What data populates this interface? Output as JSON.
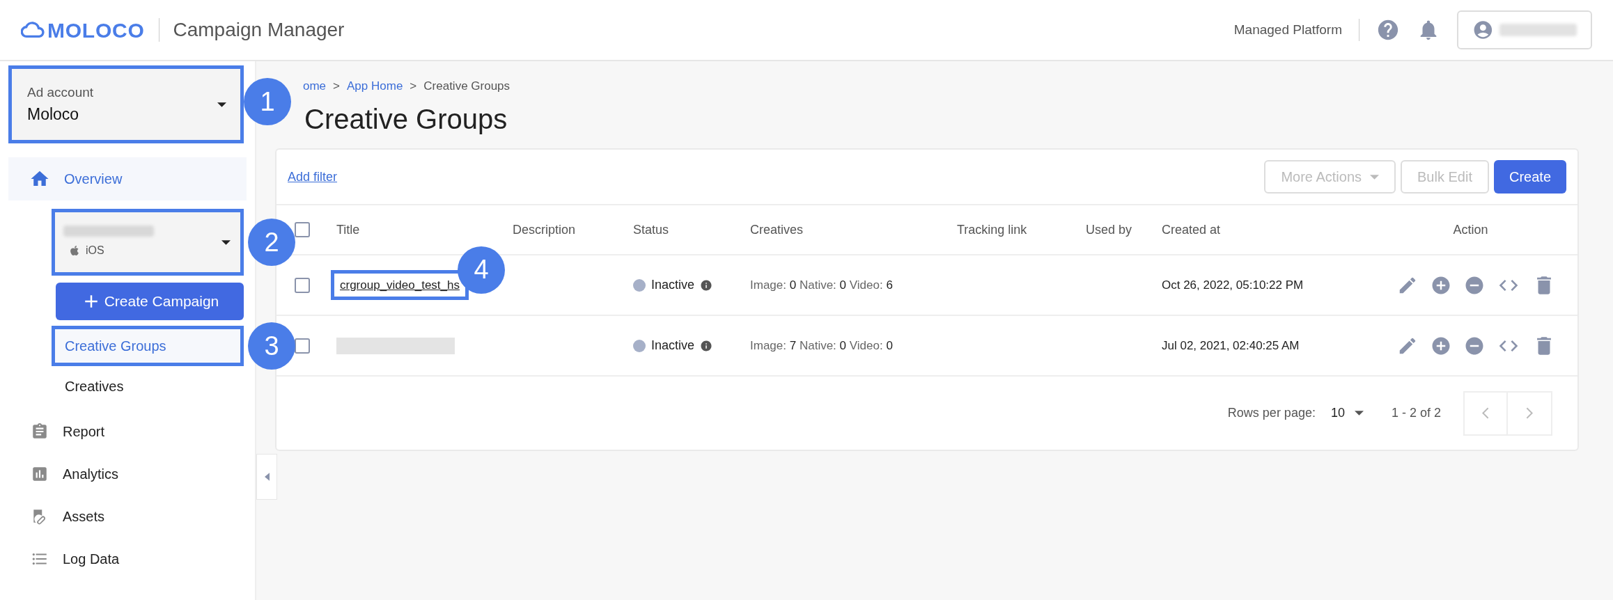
{
  "header": {
    "logo_text": "MOLOCO",
    "app_title": "Campaign Manager",
    "platform": "Managed Platform"
  },
  "sidebar": {
    "account": {
      "label": "Ad account",
      "value": "Moloco",
      "highlighted": true,
      "marker": "1"
    },
    "overview": {
      "label": "Overview",
      "selected": true
    },
    "app": {
      "platform": "iOS",
      "highlighted": true,
      "marker": "2"
    },
    "create_button": "Create Campaign",
    "sub_items": [
      {
        "label": "Creative Groups",
        "selected": true,
        "highlighted": true,
        "marker": "3"
      },
      {
        "label": "Creatives",
        "selected": false,
        "highlighted": false
      }
    ],
    "items": [
      {
        "label": "Report",
        "kind": "report"
      },
      {
        "label": "Analytics",
        "kind": "analytics"
      },
      {
        "label": "Assets",
        "kind": "assets"
      },
      {
        "label": "Log Data",
        "kind": "log"
      }
    ]
  },
  "breadcrumb": {
    "separator": ">",
    "items": [
      "ome",
      "App Home",
      "Creative Groups"
    ]
  },
  "page_title": "Creative Groups",
  "toolbar": {
    "filter_link": "Add filter",
    "buttons": [
      {
        "label": "More Actions",
        "kind": "dropdown",
        "disabled": true
      },
      {
        "label": "Bulk Edit",
        "kind": "plain",
        "disabled": true
      },
      {
        "label": "Create",
        "kind": "primary",
        "disabled": false
      }
    ]
  },
  "table": {
    "all_checked": false,
    "columns": [
      "Title",
      "Description",
      "Status",
      "Creatives",
      "Tracking link",
      "Used by",
      "Created at",
      "Action"
    ],
    "rows": [
      {
        "checked": false,
        "title": "crgroup_video_test_hs",
        "redacted": false,
        "highlighted": true,
        "marker": "4",
        "status": "Inactive",
        "creatives": [
          {
            "label": "Image:",
            "value": "0"
          },
          {
            "label": "Native:",
            "value": "0"
          },
          {
            "label": "Video:",
            "value": "6"
          }
        ],
        "created_at": "Oct 26, 2022, 05:10:22 PM"
      },
      {
        "checked": false,
        "redacted": true,
        "highlighted": false,
        "status": "Inactive",
        "creatives": [
          {
            "label": "Image:",
            "value": "7"
          },
          {
            "label": "Native:",
            "value": "0"
          },
          {
            "label": "Video:",
            "value": "0"
          }
        ],
        "created_at": "Jul 02, 2021, 02:40:25 AM"
      }
    ]
  },
  "pagination": {
    "rows_label": "Rows per page:",
    "rows_value": "10",
    "range": "1 - 2 of 2"
  }
}
